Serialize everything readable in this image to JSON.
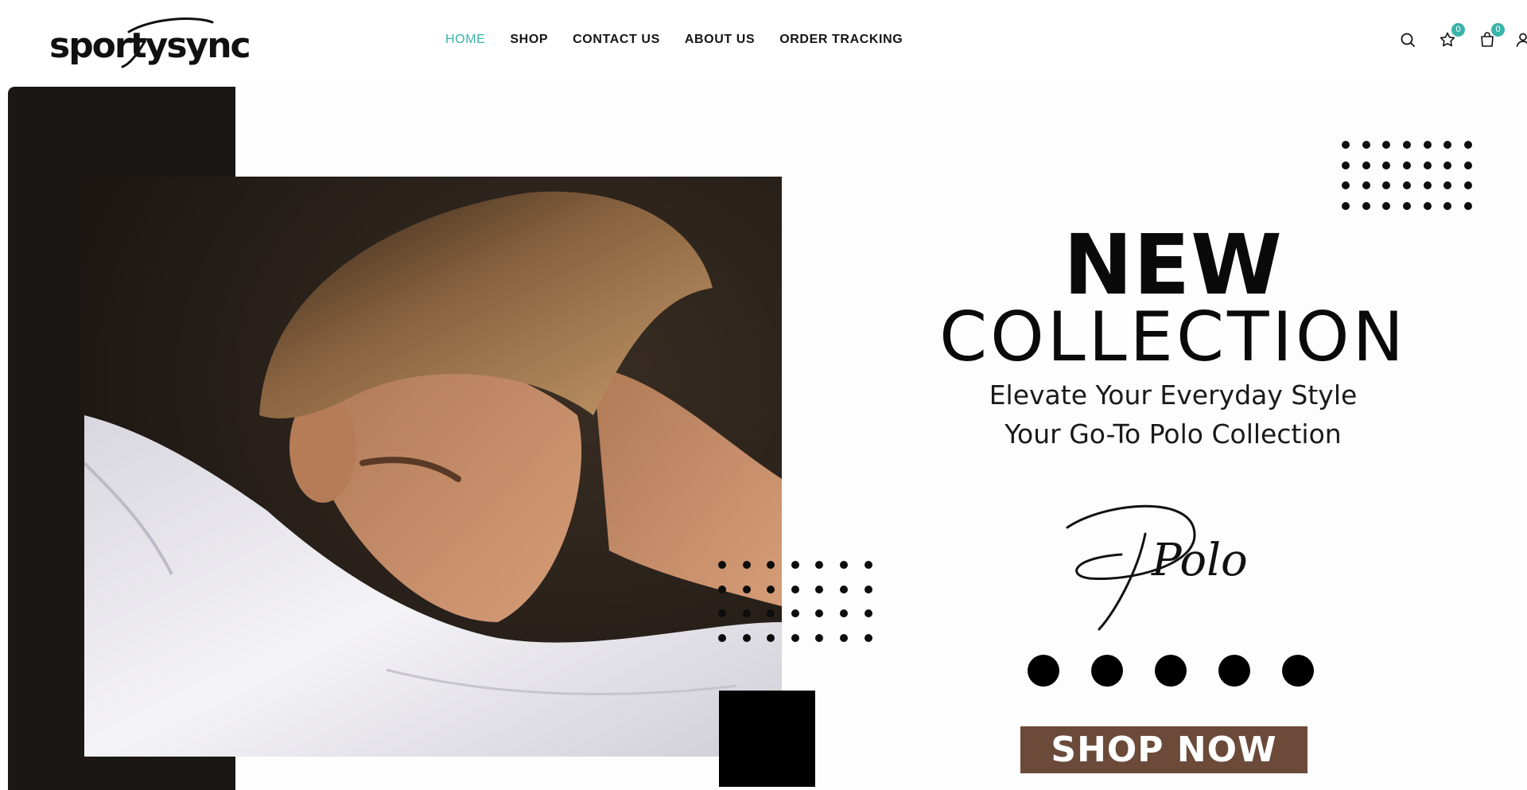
{
  "brand": {
    "logo_text": "sportysync"
  },
  "nav": {
    "items": [
      {
        "label": "HOME",
        "active": true
      },
      {
        "label": "SHOP",
        "active": false
      },
      {
        "label": "CONTACT US",
        "active": false
      },
      {
        "label": "ABOUT US",
        "active": false
      },
      {
        "label": "ORDER TRACKING",
        "active": false
      }
    ]
  },
  "header_icons": {
    "search": "search-icon",
    "wishlist": {
      "icon": "star-icon",
      "count": "0"
    },
    "cart": {
      "icon": "shopping-bag-icon",
      "count": "0"
    },
    "account": "user-icon"
  },
  "hero": {
    "headline_1": "NEW",
    "headline_2": "COLLECTION",
    "subline_1": "Elevate Your Everyday Style",
    "subline_2": "Your Go-To Polo Collection",
    "script_word": "Polo",
    "cta_label": "SHOP NOW"
  },
  "colors": {
    "accent": "#3ab3a8",
    "dark_panel": "#1b1715",
    "cta_background": "#6b4a3a",
    "text": "#111111"
  }
}
